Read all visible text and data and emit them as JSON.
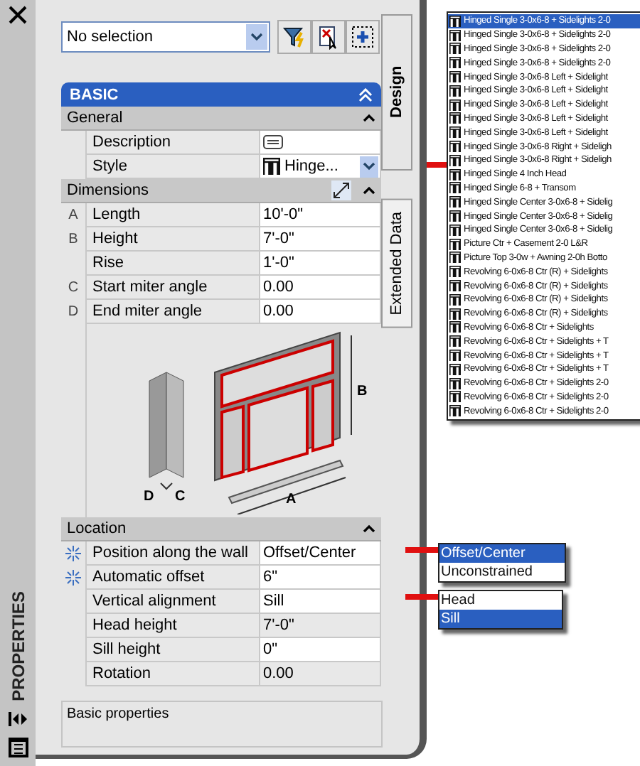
{
  "palette_title": "PROPERTIES",
  "selection": {
    "value": "No selection"
  },
  "section": {
    "title": "BASIC",
    "expanded": true
  },
  "groups": [
    {
      "title": "General",
      "expanded": true,
      "tool_icon": false,
      "rows": [
        {
          "letter": "",
          "label": "Description",
          "kind": "description",
          "value": "",
          "editable": true,
          "auto": false
        },
        {
          "letter": "",
          "label": "Style",
          "kind": "style",
          "value": "Hinge...",
          "editable": true,
          "auto": false
        }
      ]
    },
    {
      "title": "Dimensions",
      "expanded": true,
      "tool_icon": true,
      "rows": [
        {
          "letter": "A",
          "label": "Length",
          "kind": "text",
          "value": "10'-0\"",
          "editable": true,
          "auto": false
        },
        {
          "letter": "B",
          "label": "Height",
          "kind": "text",
          "value": "7'-0\"",
          "editable": true,
          "auto": false
        },
        {
          "letter": "",
          "label": "Rise",
          "kind": "text",
          "value": "1'-0\"",
          "editable": true,
          "auto": false
        },
        {
          "letter": "C",
          "label": "Start miter angle",
          "kind": "text",
          "value": "0.00",
          "editable": true,
          "auto": false
        },
        {
          "letter": "D",
          "label": "End miter angle",
          "kind": "text",
          "value": "0.00",
          "editable": true,
          "auto": false
        }
      ],
      "diagram_labels": [
        "B",
        "D",
        "C",
        "A"
      ]
    },
    {
      "title": "Location",
      "expanded": true,
      "tool_icon": false,
      "rows": [
        {
          "letter": "",
          "label": "Position along the wall",
          "kind": "text",
          "value": "Offset/Center",
          "editable": true,
          "auto": true
        },
        {
          "letter": "",
          "label": "Automatic offset",
          "kind": "text",
          "value": "6\"",
          "editable": true,
          "auto": true
        },
        {
          "letter": "",
          "label": "Vertical alignment",
          "kind": "text",
          "value": "Sill",
          "editable": true,
          "auto": false
        },
        {
          "letter": "",
          "label": "Head height",
          "kind": "text",
          "value": "7'-0\"",
          "editable": false,
          "auto": false
        },
        {
          "letter": "",
          "label": "Sill height",
          "kind": "text",
          "value": "0\"",
          "editable": true,
          "auto": false
        },
        {
          "letter": "",
          "label": "Rotation",
          "kind": "text",
          "value": "0.00",
          "editable": false,
          "auto": false
        }
      ]
    }
  ],
  "description_panel": "Basic properties",
  "side_tabs": [
    {
      "label": "Design",
      "selected": true
    },
    {
      "label": "Extended Data",
      "selected": false
    }
  ],
  "style_list": [
    {
      "label": "Hinged Single 3-0x6-8 + Sidelights 2-0",
      "selected": true
    },
    {
      "label": "Hinged Single 3-0x6-8 + Sidelights 2-0",
      "selected": false
    },
    {
      "label": "Hinged Single 3-0x6-8 + Sidelights 2-0",
      "selected": false
    },
    {
      "label": "Hinged Single 3-0x6-8 + Sidelights 2-0",
      "selected": false
    },
    {
      "label": "Hinged Single 3-0x6-8 Left + Sidelight",
      "selected": false
    },
    {
      "label": "Hinged Single 3-0x6-8 Left + Sidelight",
      "selected": false
    },
    {
      "label": "Hinged Single 3-0x6-8 Left + Sidelight",
      "selected": false
    },
    {
      "label": "Hinged Single 3-0x6-8 Left + Sidelight",
      "selected": false
    },
    {
      "label": "Hinged Single 3-0x6-8 Left + Sidelight",
      "selected": false
    },
    {
      "label": "Hinged Single 3-0x6-8 Right + Sideligh",
      "selected": false
    },
    {
      "label": "Hinged Single 3-0x6-8 Right + Sideligh",
      "selected": false
    },
    {
      "label": "Hinged Single 4 Inch Head",
      "selected": false
    },
    {
      "label": "Hinged Single 6-8 + Transom",
      "selected": false
    },
    {
      "label": "Hinged Single Center 3-0x6-8 + Sidelig",
      "selected": false
    },
    {
      "label": "Hinged Single Center 3-0x6-8 + Sidelig",
      "selected": false
    },
    {
      "label": "Hinged Single Center 3-0x6-8 + Sidelig",
      "selected": false
    },
    {
      "label": "Picture Ctr + Casement 2-0 L&R",
      "selected": false
    },
    {
      "label": "Picture Top 3-0w + Awning 2-0h Botto",
      "selected": false
    },
    {
      "label": "Revolving 6-0x6-8 Ctr (R) + Sidelights",
      "selected": false
    },
    {
      "label": "Revolving 6-0x6-8 Ctr (R) + Sidelights",
      "selected": false
    },
    {
      "label": "Revolving 6-0x6-8 Ctr (R) + Sidelights",
      "selected": false
    },
    {
      "label": "Revolving 6-0x6-8 Ctr (R) + Sidelights",
      "selected": false
    },
    {
      "label": "Revolving 6-0x6-8 Ctr + Sidelights",
      "selected": false
    },
    {
      "label": "Revolving 6-0x6-8 Ctr + Sidelights + T",
      "selected": false
    },
    {
      "label": "Revolving 6-0x6-8 Ctr + Sidelights + T",
      "selected": false
    },
    {
      "label": "Revolving 6-0x6-8 Ctr + Sidelights + T",
      "selected": false
    },
    {
      "label": "Revolving 6-0x6-8 Ctr + Sidelights 2-0",
      "selected": false
    },
    {
      "label": "Revolving 6-0x6-8 Ctr + Sidelights 2-0",
      "selected": false
    },
    {
      "label": "Revolving 6-0x6-8 Ctr + Sidelights 2-0",
      "selected": false
    }
  ],
  "position_options": [
    {
      "label": "Offset/Center",
      "selected": true
    },
    {
      "label": "Unconstrained",
      "selected": false
    }
  ],
  "alignment_options": [
    {
      "label": "Head",
      "selected": false
    },
    {
      "label": "Sill",
      "selected": true
    }
  ]
}
